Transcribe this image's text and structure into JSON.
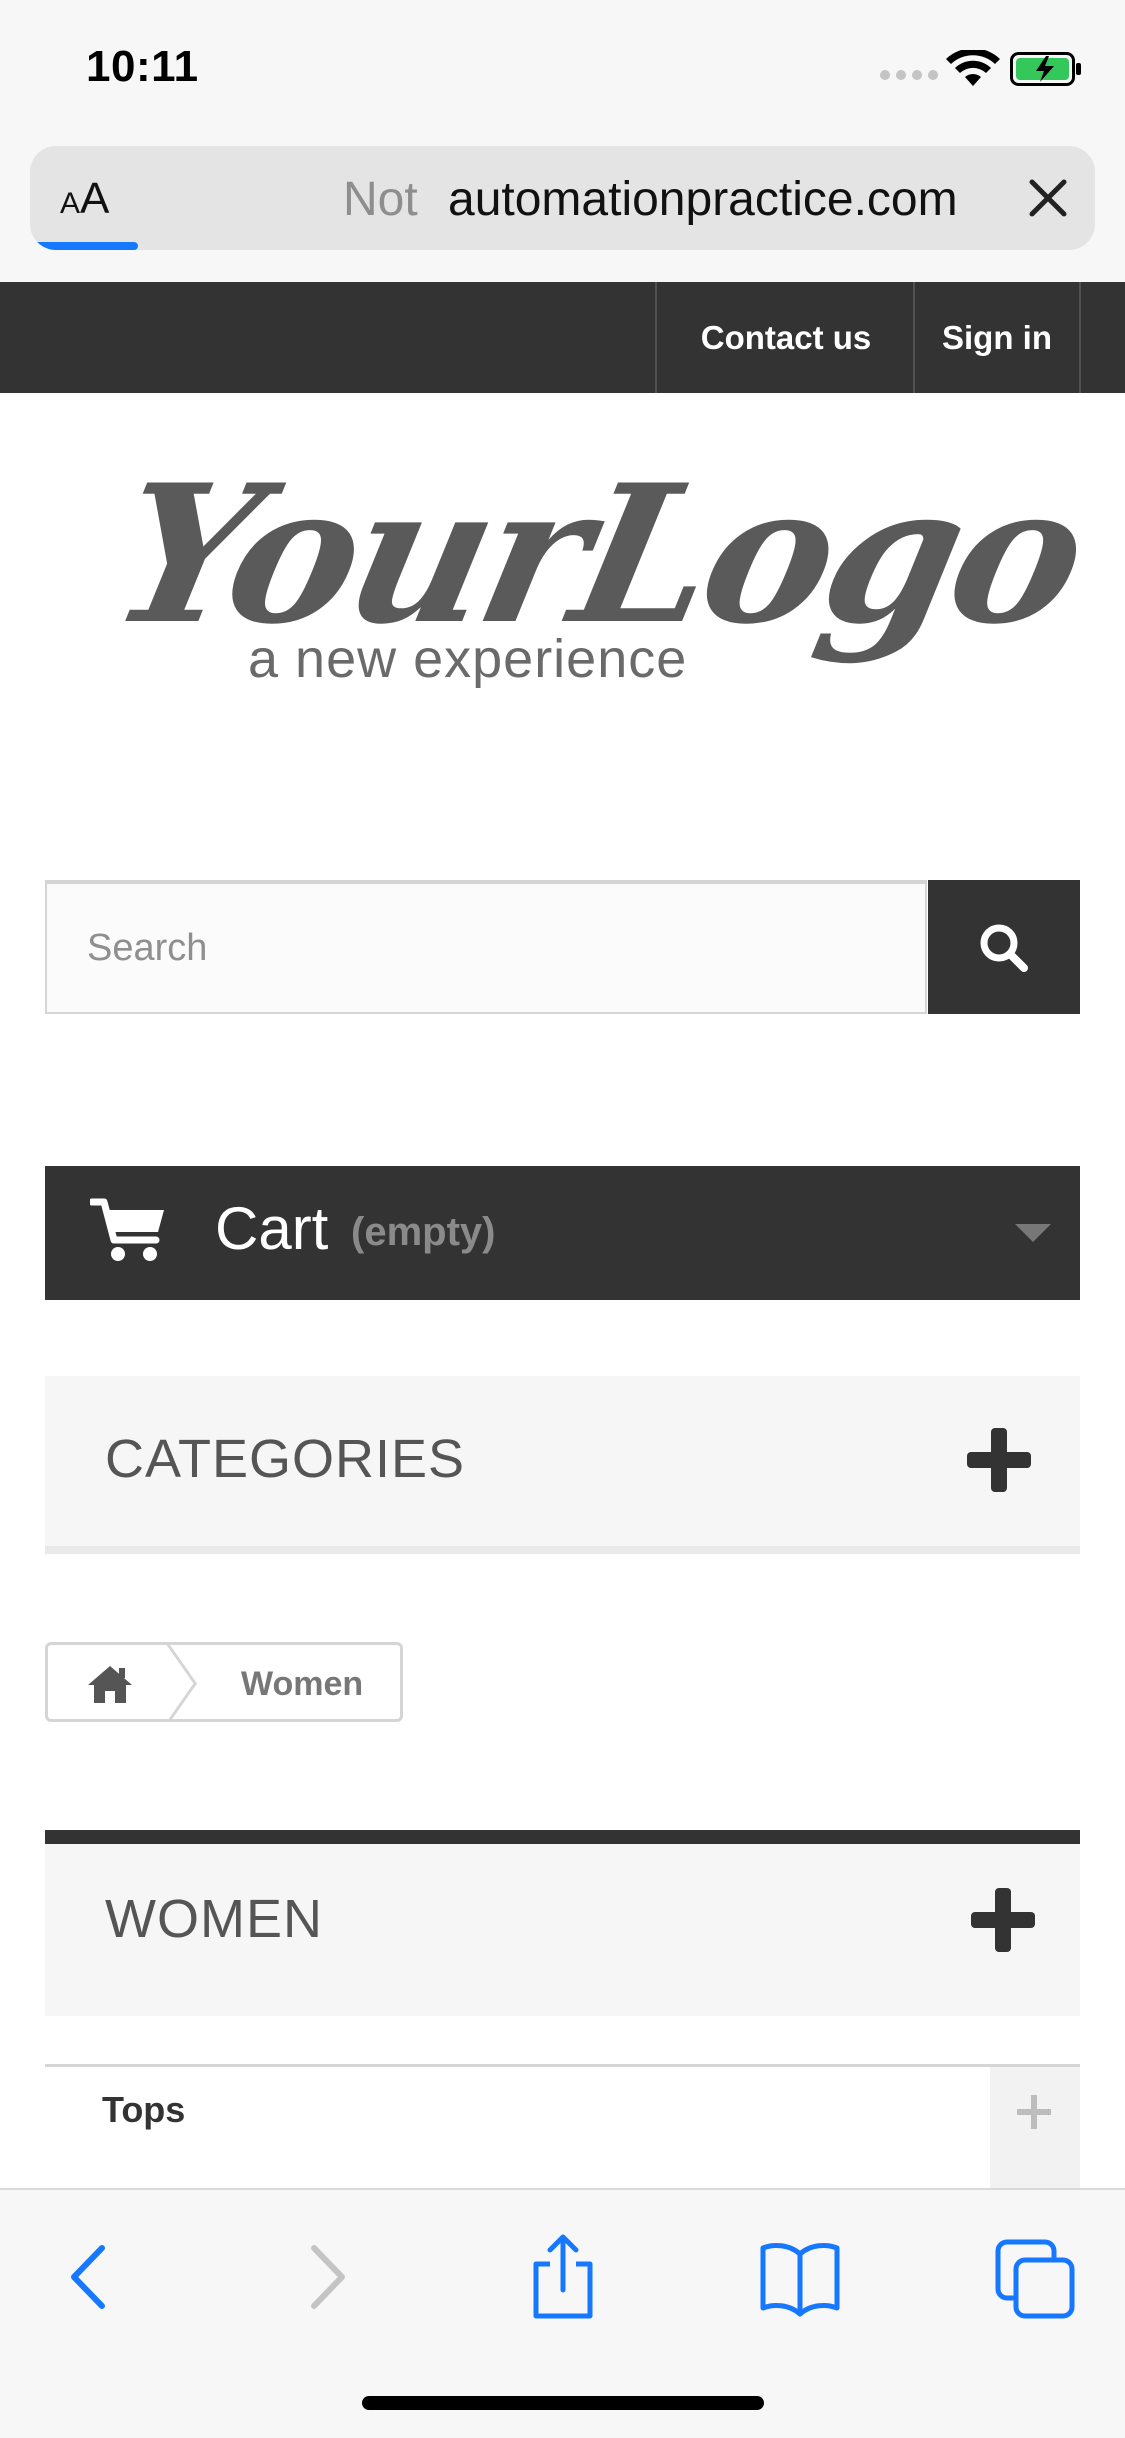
{
  "status_bar": {
    "time": "10:11"
  },
  "address_bar": {
    "text_size_label": "AA",
    "security_label": "Not",
    "url": "automationpractice.com"
  },
  "header_nav": {
    "contact_label": "Contact us",
    "signin_label": "Sign in"
  },
  "logo": {
    "script_text": "YourLogo",
    "tagline": "a new experience"
  },
  "search": {
    "placeholder": "Search"
  },
  "cart": {
    "label": "Cart",
    "status": "(empty)"
  },
  "categories_block": {
    "title": "CATEGORIES"
  },
  "breadcrumb": {
    "current": "Women"
  },
  "women_block": {
    "title": "WOMEN"
  },
  "subcategories": [
    {
      "label": "Tops"
    }
  ],
  "colors": {
    "dark": "#333333",
    "accent_blue": "#1677ff",
    "battery_green": "#34c759"
  },
  "toolbar": {
    "icons": [
      "back-icon",
      "forward-icon",
      "share-icon",
      "bookmarks-icon",
      "tabs-icon"
    ]
  }
}
